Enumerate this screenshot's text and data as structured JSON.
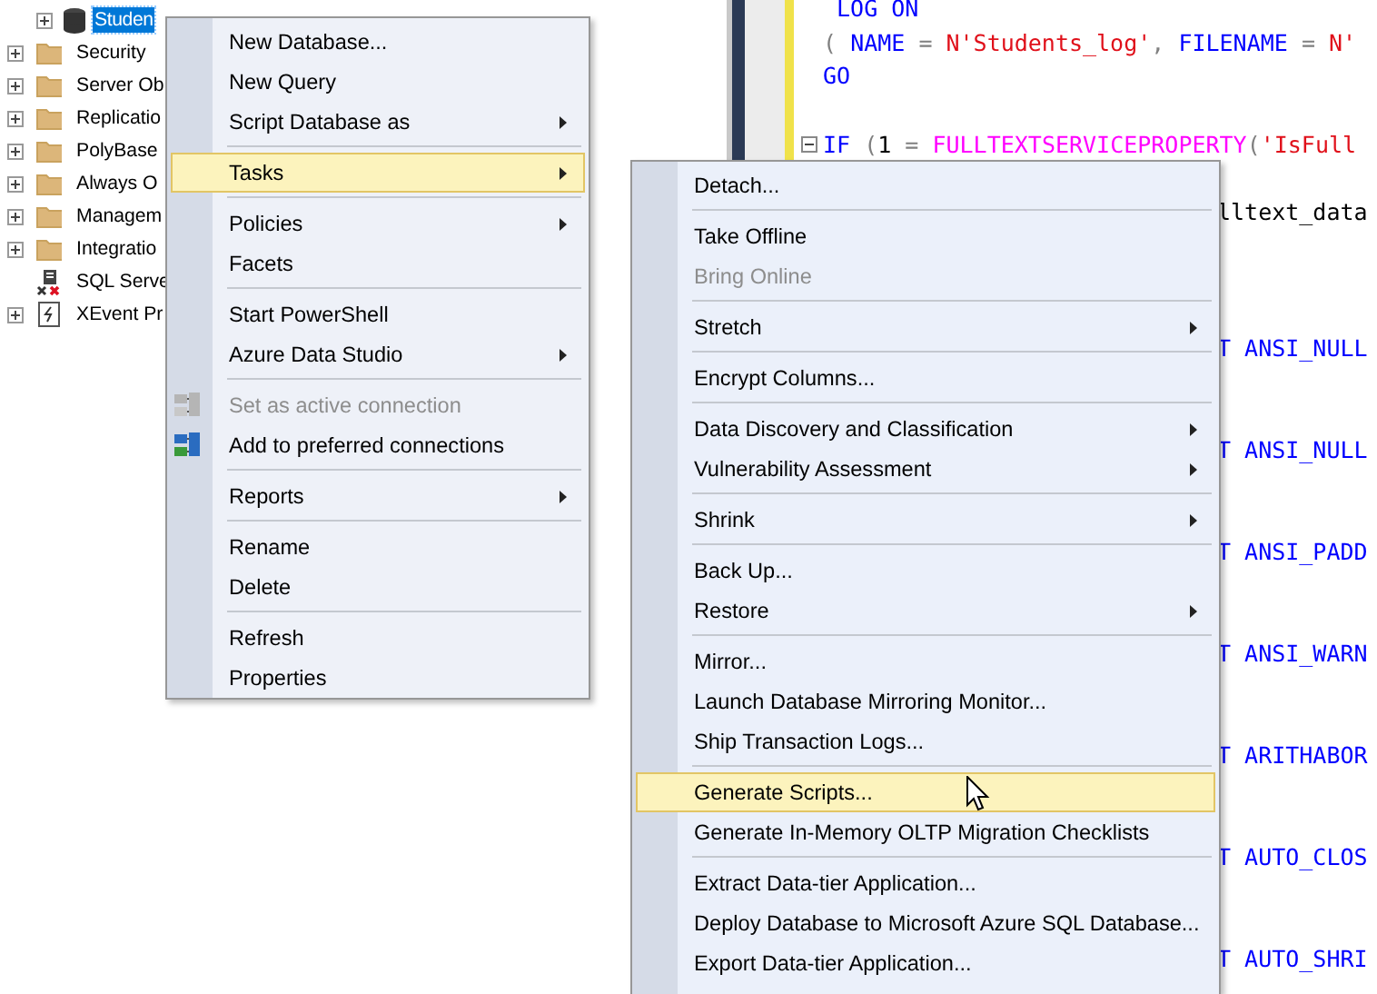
{
  "tree": {
    "databases": [
      {
        "label": "Studen",
        "kind": "database",
        "expandable": true,
        "selected": true
      }
    ],
    "items": [
      {
        "label": "Security",
        "kind": "folder",
        "expandable": true,
        "selected": false
      },
      {
        "label": "Server Ob",
        "kind": "folder",
        "expandable": true,
        "selected": false
      },
      {
        "label": "Replicatio",
        "kind": "folder",
        "expandable": true,
        "selected": false
      },
      {
        "label": "PolyBase",
        "kind": "folder",
        "expandable": true,
        "selected": false
      },
      {
        "label": "Always O",
        "kind": "folder",
        "expandable": true,
        "selected": false
      },
      {
        "label": "Managem",
        "kind": "folder",
        "expandable": true,
        "selected": false
      },
      {
        "label": "Integratio",
        "kind": "folder",
        "expandable": true,
        "selected": false
      },
      {
        "label": "SQL Serve",
        "kind": "agent",
        "expandable": false,
        "selected": false
      },
      {
        "label": "XEvent Pr",
        "kind": "xevent",
        "expandable": true,
        "selected": false
      }
    ]
  },
  "editor": {
    "lines": [
      {
        "kind": "full",
        "segments": [
          {
            "text": " LOG ON",
            "kind": "keyword"
          }
        ]
      },
      {
        "kind": "full",
        "segments": [
          {
            "text": "( ",
            "kind": "operator"
          },
          {
            "text": "NAME",
            "kind": "keyword"
          },
          {
            "text": " = ",
            "kind": "operator"
          },
          {
            "text": "N'Students_log'",
            "kind": "string"
          },
          {
            "text": ", ",
            "kind": "operator"
          },
          {
            "text": "FILENAME",
            "kind": "keyword"
          },
          {
            "text": " = ",
            "kind": "operator"
          },
          {
            "text": "N'",
            "kind": "string"
          }
        ]
      },
      {
        "kind": "full",
        "segments": [
          {
            "text": "GO",
            "kind": "keyword"
          }
        ]
      },
      {
        "kind": "blank"
      },
      {
        "kind": "full",
        "foldable": true,
        "segments": [
          {
            "text": "IF",
            "kind": "keyword"
          },
          {
            "text": " (",
            "kind": "operator"
          },
          {
            "text": "1",
            "kind": "plain"
          },
          {
            "text": " = ",
            "kind": "operator"
          },
          {
            "text": "FULLTEXTSERVICEPROPERTY",
            "kind": "function"
          },
          {
            "text": "(",
            "kind": "operator"
          },
          {
            "text": "'IsFull",
            "kind": "string"
          }
        ]
      },
      {
        "kind": "blank"
      },
      {
        "kind": "behind-menu",
        "segments": [
          {
            "text": "lltext_data",
            "kind": "plain"
          }
        ]
      },
      {
        "kind": "blank"
      },
      {
        "kind": "blank"
      },
      {
        "kind": "blank"
      },
      {
        "kind": "behind-menu",
        "segments": [
          {
            "text": "T ANSI_NULL",
            "kind": "keyword"
          }
        ]
      },
      {
        "kind": "blank"
      },
      {
        "kind": "blank"
      },
      {
        "kind": "behind-menu",
        "segments": [
          {
            "text": "T ANSI_NULL",
            "kind": "keyword"
          }
        ]
      },
      {
        "kind": "blank"
      },
      {
        "kind": "blank"
      },
      {
        "kind": "behind-menu",
        "segments": [
          {
            "text": "T ANSI_PADD",
            "kind": "keyword"
          }
        ]
      },
      {
        "kind": "blank"
      },
      {
        "kind": "blank"
      },
      {
        "kind": "behind-menu",
        "segments": [
          {
            "text": "T ANSI_WARN",
            "kind": "keyword"
          }
        ]
      },
      {
        "kind": "blank"
      },
      {
        "kind": "blank"
      },
      {
        "kind": "behind-menu",
        "segments": [
          {
            "text": "T ARITHABOR",
            "kind": "keyword"
          }
        ]
      },
      {
        "kind": "blank"
      },
      {
        "kind": "blank"
      },
      {
        "kind": "behind-menu",
        "segments": [
          {
            "text": "T AUTO_CLOS",
            "kind": "keyword"
          }
        ]
      },
      {
        "kind": "blank"
      },
      {
        "kind": "blank"
      },
      {
        "kind": "behind-menu",
        "segments": [
          {
            "text": "T AUTO_SHRI",
            "kind": "keyword"
          }
        ]
      }
    ]
  },
  "context_menu": {
    "groups": [
      [
        {
          "label": "New Database...",
          "selected": false,
          "disabled": false,
          "submenu": false,
          "icon": false
        },
        {
          "label": "New Query",
          "selected": false,
          "disabled": false,
          "submenu": false,
          "icon": false
        },
        {
          "label": "Script Database as",
          "selected": false,
          "disabled": false,
          "submenu": true,
          "icon": false
        }
      ],
      [
        {
          "label": "Tasks",
          "selected": true,
          "disabled": false,
          "submenu": true,
          "icon": false
        }
      ],
      [
        {
          "label": "Policies",
          "selected": false,
          "disabled": false,
          "submenu": true,
          "icon": false
        },
        {
          "label": "Facets",
          "selected": false,
          "disabled": false,
          "submenu": false,
          "icon": false
        }
      ],
      [
        {
          "label": "Start PowerShell",
          "selected": false,
          "disabled": false,
          "submenu": false,
          "icon": false
        },
        {
          "label": "Azure Data Studio",
          "selected": false,
          "disabled": false,
          "submenu": true,
          "icon": false
        }
      ],
      [
        {
          "label": "Set as active connection",
          "selected": false,
          "disabled": true,
          "submenu": false,
          "icon": true
        },
        {
          "label": "Add to preferred connections",
          "selected": false,
          "disabled": false,
          "submenu": false,
          "icon": true
        }
      ],
      [
        {
          "label": "Reports",
          "selected": false,
          "disabled": false,
          "submenu": true,
          "icon": false
        }
      ],
      [
        {
          "label": "Rename",
          "selected": false,
          "disabled": false,
          "submenu": false,
          "icon": false
        },
        {
          "label": "Delete",
          "selected": false,
          "disabled": false,
          "submenu": false,
          "icon": false
        }
      ],
      [
        {
          "label": "Refresh",
          "selected": false,
          "disabled": false,
          "submenu": false,
          "icon": false
        },
        {
          "label": "Properties",
          "selected": false,
          "disabled": false,
          "submenu": false,
          "icon": false
        }
      ]
    ]
  },
  "tasks_submenu": {
    "groups": [
      [
        {
          "label": "Detach...",
          "selected": false,
          "disabled": false,
          "submenu": false
        }
      ],
      [
        {
          "label": "Take Offline",
          "selected": false,
          "disabled": false,
          "submenu": false
        },
        {
          "label": "Bring Online",
          "selected": false,
          "disabled": true,
          "submenu": false
        }
      ],
      [
        {
          "label": "Stretch",
          "selected": false,
          "disabled": false,
          "submenu": true
        }
      ],
      [
        {
          "label": "Encrypt Columns...",
          "selected": false,
          "disabled": false,
          "submenu": false
        }
      ],
      [
        {
          "label": "Data Discovery and Classification",
          "selected": false,
          "disabled": false,
          "submenu": true
        },
        {
          "label": "Vulnerability Assessment",
          "selected": false,
          "disabled": false,
          "submenu": true
        }
      ],
      [
        {
          "label": "Shrink",
          "selected": false,
          "disabled": false,
          "submenu": true
        }
      ],
      [
        {
          "label": "Back Up...",
          "selected": false,
          "disabled": false,
          "submenu": false
        },
        {
          "label": "Restore",
          "selected": false,
          "disabled": false,
          "submenu": true
        }
      ],
      [
        {
          "label": "Mirror...",
          "selected": false,
          "disabled": false,
          "submenu": false
        },
        {
          "label": "Launch Database Mirroring Monitor...",
          "selected": false,
          "disabled": false,
          "submenu": false
        },
        {
          "label": "Ship Transaction Logs...",
          "selected": false,
          "disabled": false,
          "submenu": false
        }
      ],
      [
        {
          "label": "Generate Scripts...",
          "selected": true,
          "disabled": false,
          "submenu": false
        },
        {
          "label": "Generate In-Memory OLTP Migration Checklists",
          "selected": false,
          "disabled": false,
          "submenu": false
        }
      ],
      [
        {
          "label": "Extract Data-tier Application...",
          "selected": false,
          "disabled": false,
          "submenu": false
        },
        {
          "label": "Deploy Database to Microsoft Azure SQL Database...",
          "selected": false,
          "disabled": false,
          "submenu": false
        },
        {
          "label": "Export Data-tier Application...",
          "selected": false,
          "disabled": false,
          "submenu": false
        }
      ]
    ]
  }
}
